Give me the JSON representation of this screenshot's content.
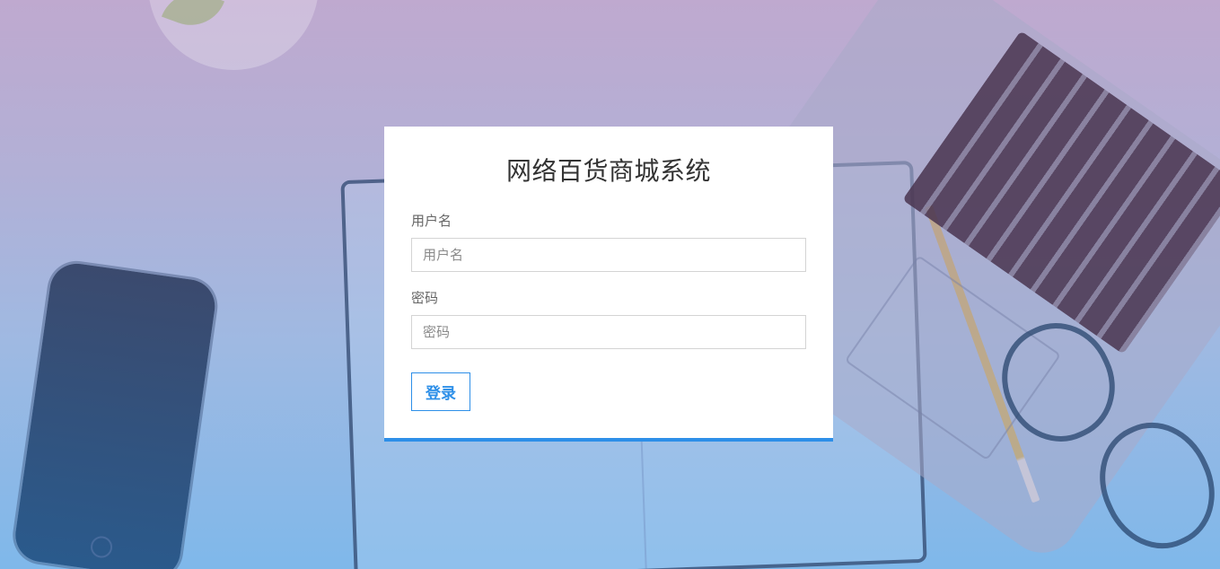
{
  "login": {
    "title": "网络百货商城系统",
    "username": {
      "label": "用户名",
      "placeholder": "用户名",
      "value": ""
    },
    "password": {
      "label": "密码",
      "placeholder": "密码",
      "value": ""
    },
    "submit_label": "登录"
  },
  "colors": {
    "accent": "#2d8fe8",
    "card_background": "#ffffff",
    "background_top": "#bfa9cf",
    "background_bottom": "#7fb8ea"
  }
}
